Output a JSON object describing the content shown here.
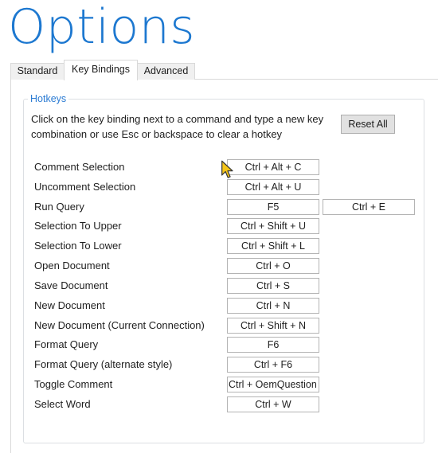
{
  "page": {
    "title": "Options"
  },
  "tabs": [
    {
      "label": "Standard",
      "selected": false
    },
    {
      "label": "Key Bindings",
      "selected": true
    },
    {
      "label": "Advanced",
      "selected": false
    }
  ],
  "hotkeys": {
    "group_label": "Hotkeys",
    "instructions": "Click on the key binding next to a command and type a new key combination or use Esc or backspace to clear a hotkey",
    "reset_label": "Reset All",
    "bindings": [
      {
        "command": "Comment Selection",
        "key1": "Ctrl + Alt + C",
        "key2": null
      },
      {
        "command": "Uncomment Selection",
        "key1": "Ctrl + Alt + U",
        "key2": null
      },
      {
        "command": "Run Query",
        "key1": "F5",
        "key2": "Ctrl + E"
      },
      {
        "command": "Selection To Upper",
        "key1": "Ctrl + Shift + U",
        "key2": null
      },
      {
        "command": "Selection To Lower",
        "key1": "Ctrl + Shift + L",
        "key2": null
      },
      {
        "command": "Open Document",
        "key1": "Ctrl + O",
        "key2": null
      },
      {
        "command": "Save Document",
        "key1": "Ctrl + S",
        "key2": null
      },
      {
        "command": "New Document",
        "key1": "Ctrl + N",
        "key2": null
      },
      {
        "command": "New Document (Current Connection)",
        "key1": "Ctrl + Shift + N",
        "key2": null
      },
      {
        "command": "Format Query",
        "key1": "F6",
        "key2": null
      },
      {
        "command": "Format Query (alternate style)",
        "key1": "Ctrl + F6",
        "key2": null
      },
      {
        "command": "Toggle Comment",
        "key1": "Ctrl + OemQuestion",
        "key2": null
      },
      {
        "command": "Select Word",
        "key1": "Ctrl + W",
        "key2": null
      }
    ]
  },
  "colors": {
    "title": "#1d78d0",
    "group_label": "#2b7bd3",
    "cursor_fill": "#f5c518"
  }
}
